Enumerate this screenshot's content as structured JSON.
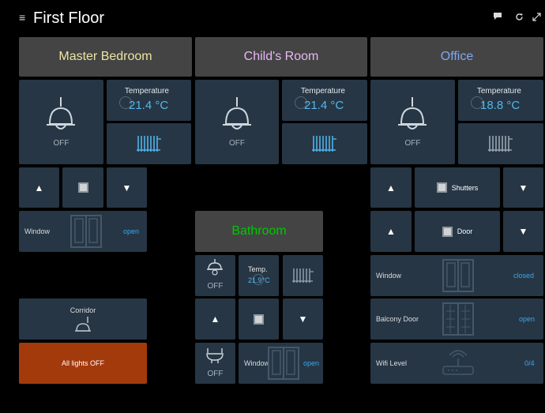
{
  "header": {
    "title": "First Floor",
    "menu_icon": "≡",
    "icons": [
      "chat-icon",
      "refresh-icon",
      "fullscreen-icon"
    ]
  },
  "colors": {
    "bg": "#000000",
    "tile": "#263645",
    "header_tile": "#444444",
    "accent_blue": "#57b6ea",
    "all_off": "#a33a0b"
  },
  "rooms": {
    "master": {
      "name": "Master Bedroom",
      "color": "#ede4a4",
      "light_state": "OFF",
      "temp_label": "Temperature",
      "temp_value": "21.4 °C"
    },
    "child": {
      "name": "Child's Room",
      "color": "#e9b8f5",
      "light_state": "OFF",
      "temp_label": "Temperature",
      "temp_value": "21.4 °C"
    },
    "office": {
      "name": "Office",
      "color": "#7fa8f2",
      "light_state": "OFF",
      "temp_label": "Temperature",
      "temp_value": "18.8 °C"
    },
    "bathroom": {
      "name": "Bathroom",
      "color": "#00c800",
      "light_state": "OFF",
      "temp_label": "Temp.",
      "temp_value": "21.9°C",
      "vent_state": "OFF",
      "window_label": "Window",
      "window_value": "open"
    }
  },
  "master_controls": {
    "window_label": "Window",
    "window_value": "open"
  },
  "corridor": {
    "label": "Corridor"
  },
  "all_lights": {
    "label": "All lights OFF"
  },
  "office_controls": {
    "shutters_label": "Shutters",
    "door_label": "Door",
    "window_label": "Window",
    "window_value": "closed",
    "balcony_label": "Balcony Door",
    "balcony_value": "open",
    "wifi_label": "Wifi Level",
    "wifi_value": "0/4"
  },
  "glyphs": {
    "up": "▲",
    "down": "▼"
  }
}
